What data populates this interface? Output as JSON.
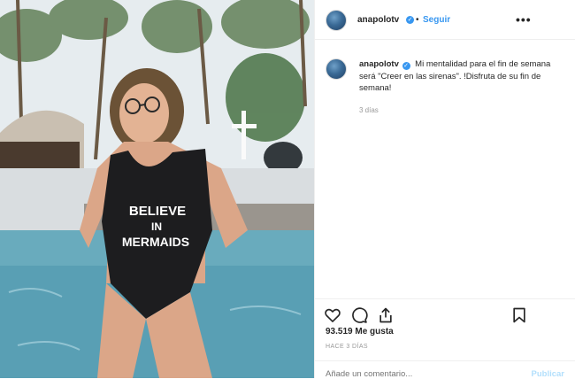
{
  "post": {
    "username": "anapolotv",
    "follow_label": "Seguir",
    "dot": "•",
    "more_label": "•••",
    "caption_text": "Mi mentalidad para el fin de semana será \"Creer en las sirenas\". !Disfruta de su fin de semana!",
    "caption_time": "3 días",
    "likes": "93.519 Me gusta",
    "time_ago": "HACE 3 DÍAS",
    "comment_placeholder": "Añade un comentario...",
    "publish_label": "Publicar"
  },
  "photo": {
    "swimsuit_text_line1": "BELIEVE",
    "swimsuit_text_line2": "IN",
    "swimsuit_text_line3": "MERMAIDS"
  },
  "colors": {
    "accent": "#3897f0",
    "muted": "#999999",
    "border": "#efefef",
    "publish_disabled": "#b2dffc"
  },
  "icons": [
    "verified-icon",
    "heart-icon",
    "comment-icon",
    "share-icon",
    "bookmark-icon",
    "more-icon"
  ]
}
